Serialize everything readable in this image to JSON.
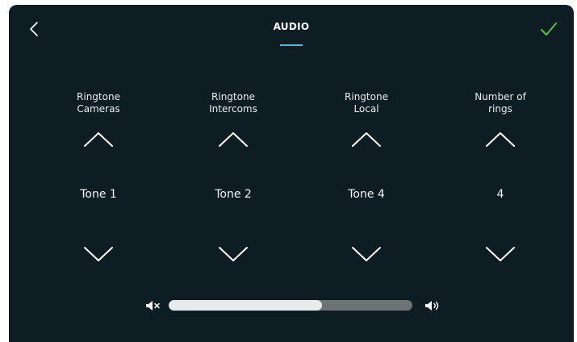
{
  "header": {
    "title": "AUDIO",
    "back_icon": "chevron-left-icon",
    "confirm_icon": "checkmark-icon",
    "confirm_color": "#4fc24b",
    "accent_color": "#5ab7d6"
  },
  "settings": [
    {
      "label": "Ringtone\nCameras",
      "value": "Tone 1"
    },
    {
      "label": "Ringtone\nIntercoms",
      "value": "Tone 2"
    },
    {
      "label": "Ringtone\nLocal",
      "value": "Tone 4"
    },
    {
      "label": "Number of\nrings",
      "value": "4"
    }
  ],
  "volume": {
    "level": 0.63,
    "min_icon": "speaker-mute-icon",
    "max_icon": "speaker-loud-icon"
  }
}
